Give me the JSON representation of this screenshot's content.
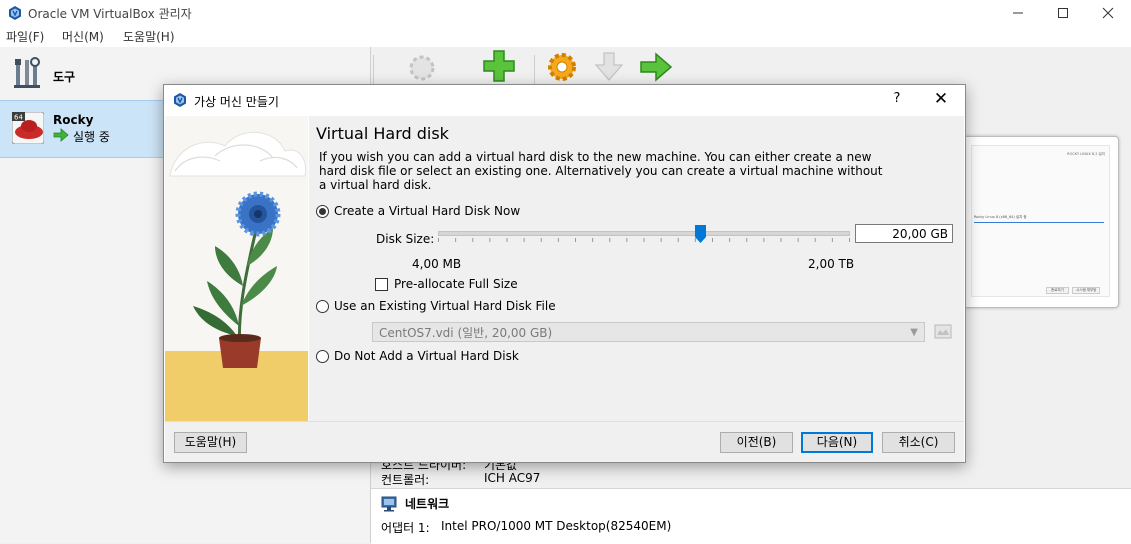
{
  "window": {
    "title": "Oracle VM VirtualBox 관리자",
    "minimize_icon": "minimize-icon",
    "maximize_icon": "maximize-icon",
    "close_icon": "close-icon"
  },
  "menu": {
    "items": [
      "파일(F)",
      "머신(M)",
      "도움말(H)"
    ]
  },
  "sidebar": {
    "tools_label": "도구",
    "vm": {
      "name": "Rocky",
      "badge": "64",
      "status": "실행 중"
    }
  },
  "details": {
    "host_driver_label": "호스트 드라이버:",
    "host_driver_value": "기본값",
    "controller_label": "컨트롤러:",
    "controller_value": "ICH AC97",
    "network_title": "네트워크",
    "adapter_label": "어댑터 1:",
    "adapter_value": "Intel PRO/1000 MT Desktop(82540EM)"
  },
  "preview": {
    "text1": "ROCKY LINUX 8.2 설치",
    "text2": "Rocky Linux 8 (x86_64) 설치 중",
    "button1": "종료하기",
    "button2": "시스템 재부팅"
  },
  "dialog": {
    "title": "가상 머신 만들기",
    "help_symbol": "?",
    "close_symbol": "✕",
    "heading": "Virtual Hard disk",
    "description": "If you wish you can add a virtual hard disk to the new machine. You can either create a new hard disk file or select an existing one. Alternatively you can create a virtual machine without a virtual hard disk.",
    "option_create": "Create a Virtual Hard Disk Now",
    "disk_size_label": "Disk Size:",
    "disk_size_value": "20,00 GB",
    "slider_level": 0.64,
    "slider_min_label": "4,00 MB",
    "slider_max_label": "2,00 TB",
    "preallocate_label": "Pre-allocate Full Size",
    "option_existing": "Use an Existing Virtual Hard Disk File",
    "existing_file": "CentOS7.vdi (일반, 20,00 GB)",
    "option_none": "Do Not Add a Virtual Hard Disk",
    "selected_option": "create",
    "buttons": {
      "help": "도움말(H)",
      "back": "이전(B)",
      "next": "다음(N)",
      "cancel": "취소(C)"
    }
  }
}
